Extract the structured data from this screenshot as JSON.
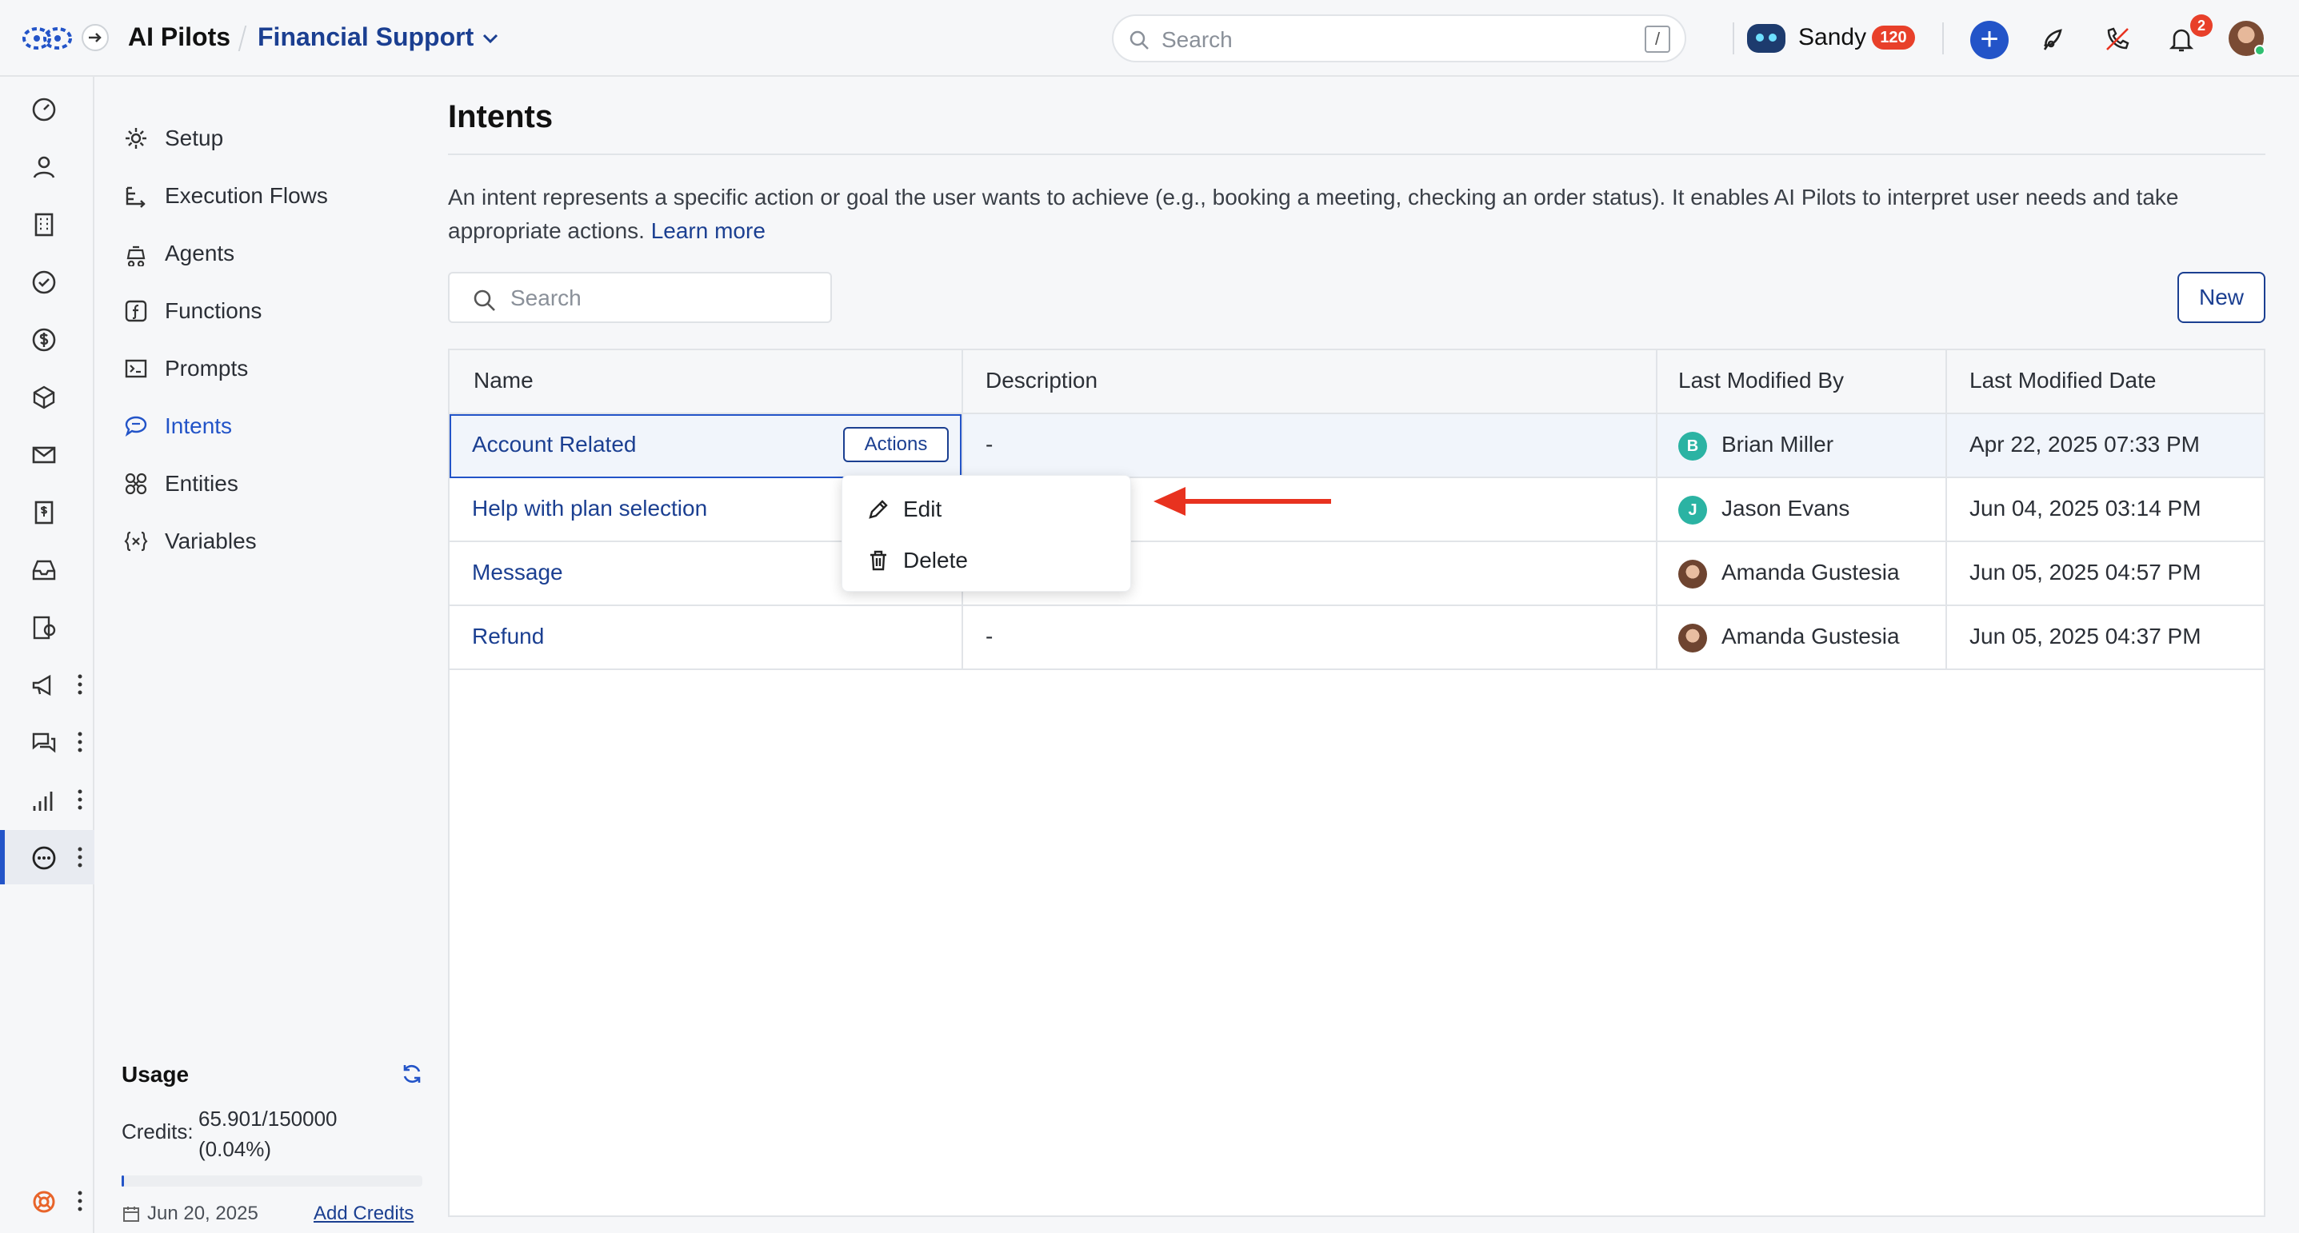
{
  "header": {
    "app_title": "AI Pilots",
    "project_name": "Financial Support",
    "search_placeholder": "Search",
    "search_shortcut": "/",
    "user_name": "Sandy",
    "user_badge": "120",
    "notification_count": "2",
    "icons": [
      "logo-icon",
      "collapse-arrow-icon",
      "chevron-down-icon",
      "search-icon",
      "bot-avatar",
      "plus-icon",
      "rocket-icon",
      "phone-off-icon",
      "bell-icon",
      "profile-avatar"
    ]
  },
  "rail": {
    "icons": [
      "dashboard-icon",
      "contacts-icon",
      "building-icon",
      "check-circle-icon",
      "dollar-icon",
      "cube-icon",
      "mail-icon",
      "invoice-icon",
      "inbox-icon",
      "form-icon",
      "megaphone-icon",
      "chat-icon",
      "analytics-icon",
      "ai-pilot-icon",
      "help-ring-icon"
    ]
  },
  "subnav": {
    "items": [
      {
        "label": "Setup",
        "icon": "gear-icon"
      },
      {
        "label": "Execution Flows",
        "icon": "flow-icon"
      },
      {
        "label": "Agents",
        "icon": "agent-icon"
      },
      {
        "label": "Functions",
        "icon": "function-icon"
      },
      {
        "label": "Prompts",
        "icon": "terminal-icon"
      },
      {
        "label": "Intents",
        "icon": "intent-icon",
        "active": true
      },
      {
        "label": "Entities",
        "icon": "entities-icon"
      },
      {
        "label": "Variables",
        "icon": "variables-icon"
      }
    ]
  },
  "usage": {
    "title": "Usage",
    "credits_label": "Credits:",
    "credits_value": "65.901/150000",
    "credits_percent": "(0.04%)",
    "credits_fraction": 0.0004,
    "date": "Jun 20, 2025",
    "add_credits": "Add Credits"
  },
  "main": {
    "title": "Intents",
    "description": "An intent represents a specific action or goal the user wants to achieve (e.g., booking a meeting, checking an order status). It enables AI Pilots to interpret user needs and take appropriate actions.",
    "learn_more": "Learn more",
    "search_placeholder": "Search",
    "new_button": "New"
  },
  "table": {
    "columns": [
      "Name",
      "Description",
      "Last Modified By",
      "Last Modified Date"
    ],
    "rows": [
      {
        "name": "Account Related",
        "description": "-",
        "modified_by": "Brian Miller",
        "avatar_initial": "B",
        "avatar_color": "#2bb3a3",
        "modified_date": "Apr 22, 2025 07:33 PM"
      },
      {
        "name": "Help with plan selection",
        "description": "",
        "modified_by": "Jason Evans",
        "avatar_initial": "J",
        "avatar_color": "#2bb3a3",
        "modified_date": "Jun 04, 2025 03:14 PM"
      },
      {
        "name": "Message",
        "description": "",
        "modified_by": "Amanda Gustesia",
        "avatar_initial": "",
        "avatar_color": "",
        "modified_date": "Jun 05, 2025 04:57 PM"
      },
      {
        "name": "Refund",
        "description": "-",
        "modified_by": "Amanda Gustesia",
        "avatar_initial": "",
        "avatar_color": "",
        "modified_date": "Jun 05, 2025 04:37 PM"
      }
    ],
    "actions_button": "Actions"
  },
  "actions_menu": {
    "items": [
      {
        "label": "Edit",
        "icon": "pencil-icon"
      },
      {
        "label": "Delete",
        "icon": "trash-icon"
      }
    ]
  },
  "colors": {
    "brand": "#1b3f91",
    "accent": "#2354c8",
    "arrow": "#e8321f",
    "badge": "#e8402a"
  }
}
